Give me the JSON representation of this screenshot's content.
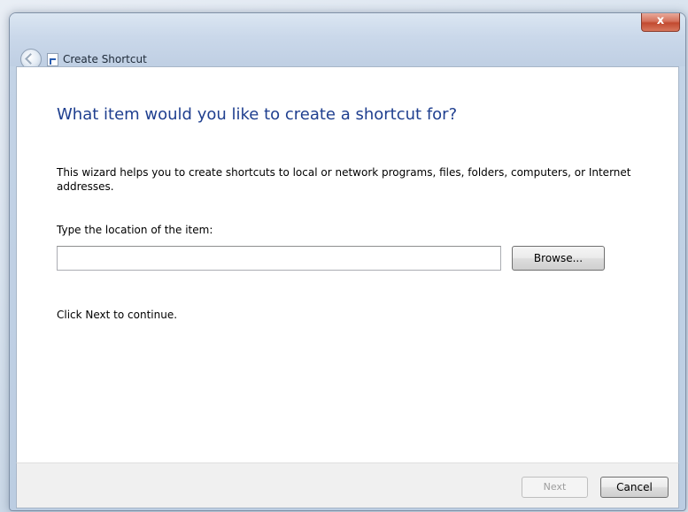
{
  "window": {
    "title": "Create Shortcut",
    "close_glyph": "x"
  },
  "wizard": {
    "heading": "What item would you like to create a shortcut for?",
    "intro": "This wizard helps you to create shortcuts to local or network programs, files, folders, computers, or Internet addresses.",
    "location_label": "Type the location of the item:",
    "location_value": "",
    "browse_label": "Browse...",
    "hint": "Click Next to continue."
  },
  "footer": {
    "next_label": "Next",
    "cancel_label": "Cancel"
  },
  "icons": {
    "back": "back-arrow-icon",
    "app": "shortcut-icon",
    "close": "close-icon"
  },
  "colors": {
    "heading": "#1f3f8f",
    "close_button": "#c24a30",
    "disabled_text": "#9d9d9d"
  }
}
